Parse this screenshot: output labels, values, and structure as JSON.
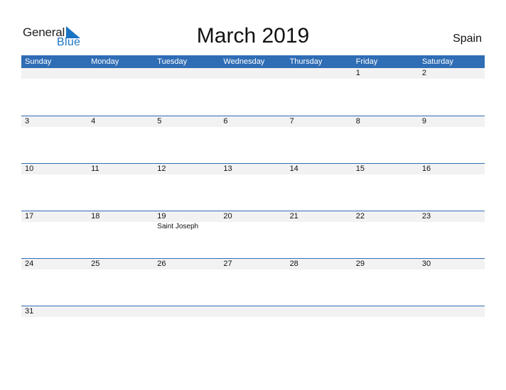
{
  "brand": {
    "name_part1": "General",
    "name_part2": "Blue",
    "colors": {
      "accent": "#2f6db5",
      "logo_blue": "#1a74c4",
      "day_bar": "#f2f2f2"
    }
  },
  "calendar": {
    "title": "March 2019",
    "country": "Spain",
    "weekdays": [
      "Sunday",
      "Monday",
      "Tuesday",
      "Wednesday",
      "Thursday",
      "Friday",
      "Saturday"
    ],
    "weeks": [
      [
        "",
        "",
        "",
        "",
        "",
        "1",
        "2"
      ],
      [
        "3",
        "4",
        "5",
        "6",
        "7",
        "8",
        "9"
      ],
      [
        "10",
        "11",
        "12",
        "13",
        "14",
        "15",
        "16"
      ],
      [
        "17",
        "18",
        "19",
        "20",
        "21",
        "22",
        "23"
      ],
      [
        "24",
        "25",
        "26",
        "27",
        "28",
        "29",
        "30"
      ],
      [
        "31",
        "",
        "",
        "",
        "",
        "",
        ""
      ]
    ],
    "holidays": [
      {
        "day": "19",
        "name": "Saint Joseph"
      }
    ]
  }
}
